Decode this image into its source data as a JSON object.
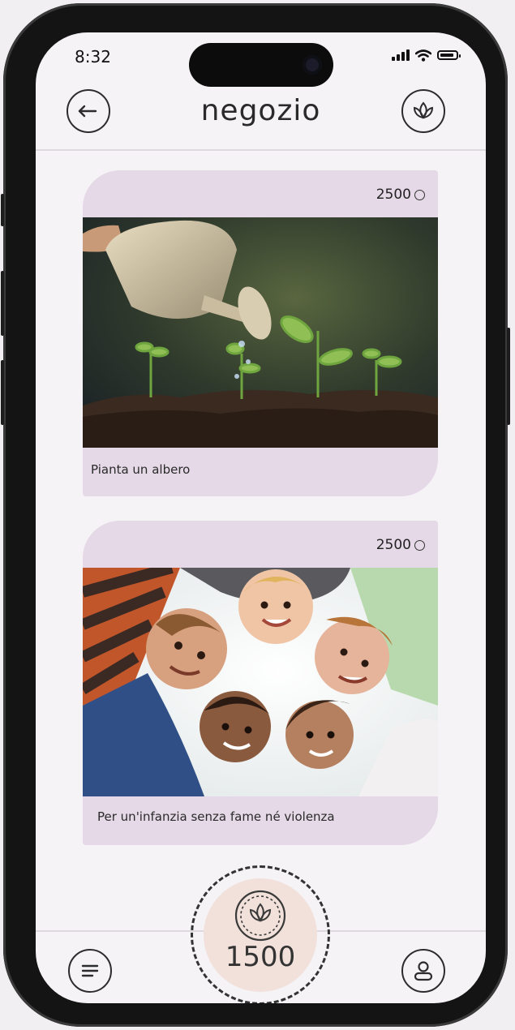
{
  "status_bar": {
    "time": "8:32"
  },
  "header": {
    "title": "negozio",
    "back_icon": "back-arrow-icon",
    "right_icon": "lotus-icon"
  },
  "shop_items": [
    {
      "price": "2500",
      "price_icon": "coin-icon",
      "label": "Pianta un albero",
      "image": "watering-can-seedlings-photo"
    },
    {
      "price": "2500",
      "price_icon": "coin-icon",
      "label": "Per un'infanzia senza fame né violenza",
      "image": "children-huddle-photo"
    }
  ],
  "bottom_nav": {
    "menu_icon": "menu-icon",
    "balance": "1500",
    "balance_icon": "lotus-coin-icon",
    "profile_icon": "profile-icon"
  },
  "colors": {
    "card": "#e5d8e7",
    "coin": "#f1e1da",
    "background": "#f5f3f6"
  }
}
